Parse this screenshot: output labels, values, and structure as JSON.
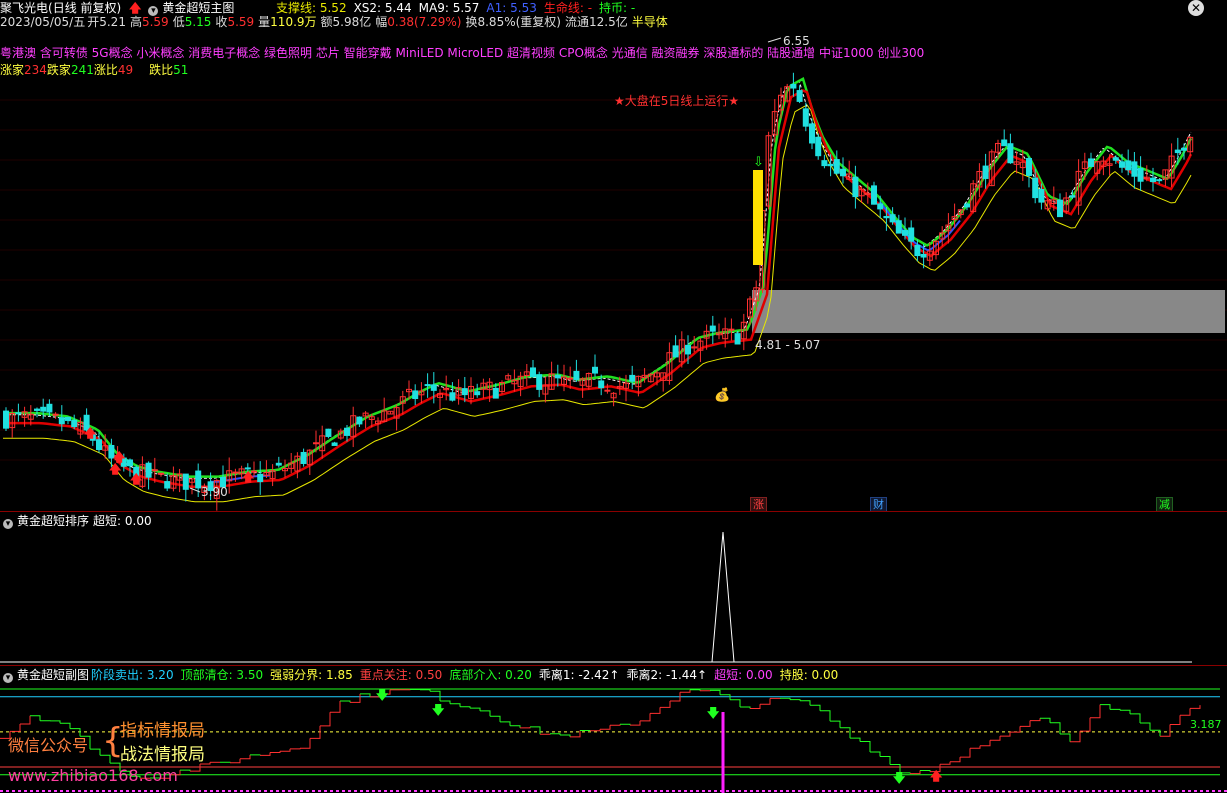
{
  "main_header": {
    "stock_name": "聚飞光电",
    "period": "(日线 前复权)",
    "indicator": "黄金超短主图",
    "items": [
      {
        "label": "支撑线: 5.52",
        "color": "#e8e800"
      },
      {
        "label": "XS2: 5.44",
        "color": "#ffffff"
      },
      {
        "label": "MA9: 5.57",
        "color": "#ffffff"
      },
      {
        "label": "A1: 5.53",
        "color": "#4060ff"
      },
      {
        "label": "生命线: -",
        "color": "#ff2020"
      },
      {
        "label": "持币: -",
        "color": "#20ff20"
      }
    ]
  },
  "quote": {
    "date": "2023/05/05/五",
    "open_label": "开",
    "open": "5.21",
    "high_label": "高",
    "high": "5.59",
    "low_label": "低",
    "low": "5.15",
    "close_label": "收",
    "close": "5.59",
    "vol_label": "量",
    "vol": "110.9万",
    "amt": "额5.98亿",
    "chg_label": "幅",
    "chg": "0.38(7.29%)",
    "turnover": "换8.85%(重复权)",
    "float": "流通12.5亿",
    "sector": "半导体"
  },
  "concepts": "粤港澳 含可转债 5G概念 小米概念 消费电子概念 绿色照明 芯片 智能穿戴 MiniLED MicroLED 超清视频 CPO概念 光通信 融资融券 深股通标的 陆股通增 中证1000 创业300",
  "breadth": {
    "up_label": "涨家",
    "up": "234",
    "down_label": "跌家",
    "down": "241",
    "up_ratio_label": "涨比",
    "up_ratio": "49",
    "down_ratio_label": "跌比",
    "down_ratio": "51"
  },
  "annotations": {
    "banner": "★大盘在5日线上运行★",
    "high_label": "6.55",
    "low_label": "3.90",
    "zone_label": "4.81 - 5.07",
    "tag_zhang": "涨",
    "tag_cai": "财",
    "tag_jian": "减"
  },
  "sub1_header": {
    "title": "黄金超短排序",
    "value": "超短: 0.00"
  },
  "sub2_header": {
    "title": "黄金超短副图",
    "items": [
      {
        "label": "阶段卖出: 3.20",
        "color": "#20d0ff"
      },
      {
        "label": "顶部清仓: 3.50",
        "color": "#20ff20"
      },
      {
        "label": "强弱分界: 1.85",
        "color": "#ffff40"
      },
      {
        "label": "重点关注: 0.50",
        "color": "#ff4040"
      },
      {
        "label": "底部介入: 0.20",
        "color": "#20ff20"
      },
      {
        "label": "乖离1: -2.42↑",
        "color": "#ffffff"
      },
      {
        "label": "乖离2: -1.44↑",
        "color": "#ffffff"
      },
      {
        "label": "超短: 0.00",
        "color": "#ff40ff"
      },
      {
        "label": "持股: 0.00",
        "color": "#ffff40"
      }
    ],
    "right_value": "3.187"
  },
  "watermark": {
    "wechat": "微信公众号",
    "line1": "指标情报局",
    "line2": "战法情报局",
    "url": "www.zhibiao168.com"
  },
  "colors": {
    "up": "#ff3030",
    "down": "#20e0e0",
    "ma_green": "#20e020",
    "ma_red": "#e00000",
    "support": "#e8e800"
  }
}
